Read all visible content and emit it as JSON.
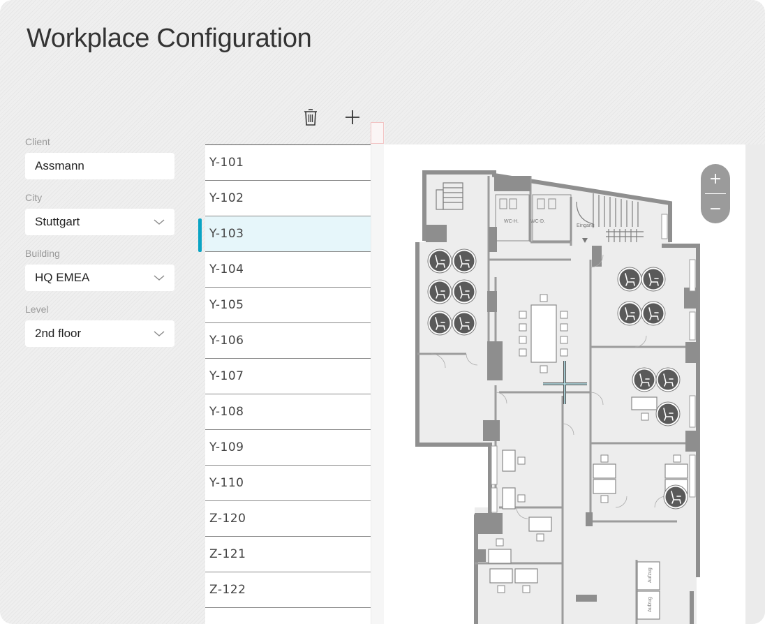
{
  "page": {
    "title": "Workplace Configuration"
  },
  "filters": {
    "client": {
      "label": "Client",
      "value": "Assmann"
    },
    "city": {
      "label": "City",
      "value": "Stuttgart"
    },
    "building": {
      "label": "Building",
      "value": "HQ EMEA"
    },
    "level": {
      "label": "Level",
      "value": "2nd floor"
    }
  },
  "toolbar": {
    "delete_icon": "trash-icon",
    "add_icon": "plus-icon"
  },
  "rooms": {
    "selected": "Y-103",
    "items": [
      "Y-101",
      "Y-102",
      "Y-103",
      "Y-104",
      "Y-105",
      "Y-106",
      "Y-107",
      "Y-108",
      "Y-109",
      "Y-110",
      "Z-120",
      "Z-121",
      "Z-122"
    ]
  },
  "map": {
    "zoom_in": "+",
    "zoom_out": "−",
    "labels": {
      "wc_h": "WC-H.",
      "wc_d": "WC-D.",
      "entrance": "Eingang",
      "lift1": "Aufzug",
      "lift2": "Aufzug"
    }
  },
  "colors": {
    "accent": "#0aa4c4",
    "selected_bg": "#e6f6fa",
    "wall": "#8e8e8e",
    "floor": "#ececec",
    "desk_icon": "#5a5a5a"
  }
}
